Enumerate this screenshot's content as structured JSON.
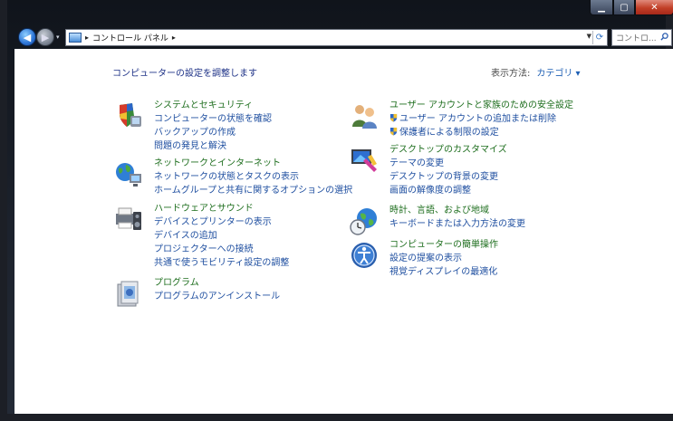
{
  "breadcrumb": {
    "items": [
      "コントロール パネル"
    ]
  },
  "search": {
    "placeholder": "コントロ..."
  },
  "main": {
    "heading": "コンピューターの設定を調整します",
    "view_by": {
      "label": "表示方法:",
      "value": "カテゴリ ▾"
    }
  },
  "categories": [
    {
      "title": "システムとセキュリティ",
      "icon": "security-shield-icon",
      "links": [
        "コンピューターの状態を確認",
        "バックアップの作成",
        "問題の発見と解決"
      ]
    },
    {
      "title": "ネットワークとインターネット",
      "icon": "network-globe-icon",
      "links": [
        "ネットワークの状態とタスクの表示",
        "ホームグループと共有に関するオプションの選択"
      ]
    },
    {
      "title": "ハードウェアとサウンド",
      "icon": "printer-speaker-icon",
      "links": [
        "デバイスとプリンターの表示",
        "デバイスの追加",
        "プロジェクターへの接続",
        "共通で使うモビリティ設定の調整"
      ]
    },
    {
      "title": "プログラム",
      "icon": "programs-icon",
      "links": [
        "プログラムのアンインストール"
      ]
    },
    {
      "title": "ユーザー アカウントと家族のための安全設定",
      "icon": "user-accounts-icon",
      "links": [
        "ユーザー アカウントの追加または削除",
        "保護者による制限の設定"
      ]
    },
    {
      "title": "デスクトップのカスタマイズ",
      "icon": "desktop-customize-icon",
      "links": [
        "テーマの変更",
        "デスクトップの背景の変更",
        "画面の解像度の調整"
      ]
    },
    {
      "title": "時計、言語、および地域",
      "icon": "clock-globe-icon",
      "links": [
        "キーボードまたは入力方法の変更"
      ]
    },
    {
      "title": "コンピューターの簡単操作",
      "icon": "ease-of-access-icon",
      "links": [
        "設定の提案の表示",
        "視覚ディスプレイの最適化"
      ]
    }
  ],
  "colors": {
    "category_title": "#1e6e1e",
    "link": "#1f4fa0",
    "heading": "#1e3287"
  }
}
